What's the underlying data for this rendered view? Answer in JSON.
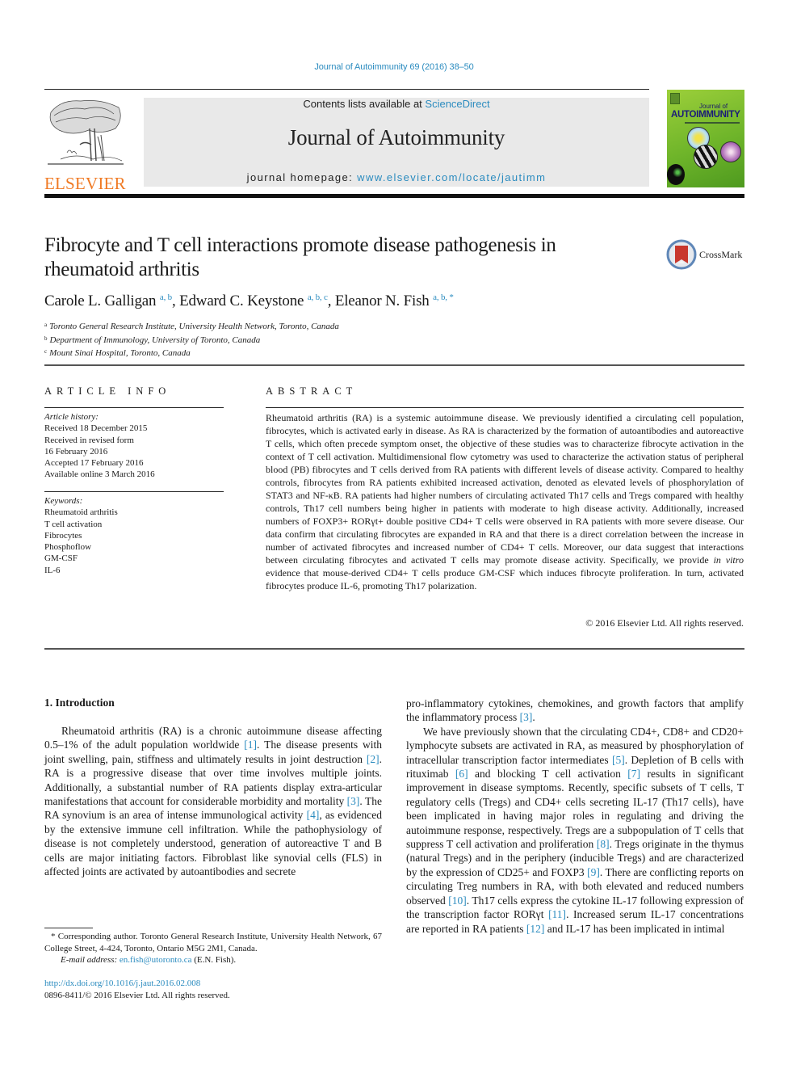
{
  "header": {
    "journal_reference": "Journal of Autoimmunity 69 (2016) 38–50",
    "publisher_wordmark": "ELSEVIER",
    "contents_prefix": "Contents lists available at ",
    "contents_link": "ScienceDirect",
    "journal_title": "Journal of Autoimmunity",
    "homepage_prefix": "journal homepage: ",
    "homepage_link": "www.elsevier.com/locate/jautimm",
    "cover": {
      "small_text": "Journal of",
      "big_text": "AUTOIMMUNITY"
    },
    "colors": {
      "link": "#2a8bbf",
      "elsevier_orange": "#f07a24",
      "cover_green": "#7dbf2e"
    }
  },
  "article": {
    "title": "Fibrocyte and T cell interactions promote disease pathogenesis in rheumatoid arthritis",
    "crossmark_label": "CrossMark",
    "authors": [
      {
        "name": "Carole L. Galligan",
        "sup": "a, b",
        "sep": ", "
      },
      {
        "name": "Edward C. Keystone",
        "sup": "a, b, c",
        "sep": ", "
      },
      {
        "name": "Eleanor N. Fish",
        "sup": "a, b, *",
        "sep": ""
      }
    ],
    "affiliations": [
      {
        "key": "a",
        "text": "Toronto General Research Institute, University Health Network, Toronto, Canada"
      },
      {
        "key": "b",
        "text": "Department of Immunology, University of Toronto, Canada"
      },
      {
        "key": "c",
        "text": "Mount Sinai Hospital, Toronto, Canada"
      }
    ]
  },
  "article_info": {
    "heading": "ARTICLE INFO",
    "history_label": "Article history:",
    "history": [
      "Received 18 December 2015",
      "Received in revised form",
      "16 February 2016",
      "Accepted 17 February 2016",
      "Available online 3 March 2016"
    ],
    "keywords_label": "Keywords:",
    "keywords": [
      "Rheumatoid arthritis",
      "T cell activation",
      "Fibrocytes",
      "Phosphoflow",
      "GM-CSF",
      "IL-6"
    ]
  },
  "abstract": {
    "heading": "ABSTRACT",
    "text_before_italic": "Rheumatoid arthritis (RA) is a systemic autoimmune disease. We previously identified a circulating cell population, fibrocytes, which is activated early in disease. As RA is characterized by the formation of autoantibodies and autoreactive T cells, which often precede symptom onset, the objective of these studies was to characterize fibrocyte activation in the context of T cell activation. Multidimensional flow cytometry was used to characterize the activation status of peripheral blood (PB) fibrocytes and T cells derived from RA patients with different levels of disease activity. Compared to healthy controls, fibro­cytes from RA patients exhibited increased activation, denoted as elevated levels of phosphorylation of STAT3 and NF-κB. RA patients had higher numbers of circulating activated Th17 cells and Tregs compared with healthy controls, Th17 cell numbers being higher in patients with moderate to high disease activity. Additionally, increased numbers of FOXP3+ RORγt+ double positive CD4+ T cells were observed in RA patients with more severe disease. Our data confirm that circulating fibrocytes are expanded in RA and that there is a direct correlation between the increase in number of activated fibrocytes and increased number of CD4+ T cells. Moreover, our data suggest that interactions between circulating fibrocytes and activated T cells may promote disease activity. Specifically, we provide ",
    "italic": "in vitro",
    "text_after_italic": " evidence that mouse-derived CD4+ T cells produce GM-CSF which induces fibrocyte proliferation. In turn, activated fibro­cytes produce IL-6, promoting Th17 polarization.",
    "copyright": "© 2016 Elsevier Ltd. All rights reserved."
  },
  "introduction": {
    "heading": "1.  Introduction",
    "left_column": [
      {
        "t": "Rheumatoid arthritis (RA) is a chronic autoimmune disease affecting 0.5–1% of the adult population worldwide "
      },
      {
        "ref": "[1]"
      },
      {
        "t": ". The disease presents with joint swelling, pain, stiffness and ultimately results in joint destruction "
      },
      {
        "ref": "[2]"
      },
      {
        "t": ". RA is a progressive disease that over time involves multiple joints. Additionally, a substantial number of RA patients display extra-articular manifestations that account for considerable morbidity and mortality "
      },
      {
        "ref": "[3]"
      },
      {
        "t": ". The RA synovium is an area of intense immunological activity "
      },
      {
        "ref": "[4]"
      },
      {
        "t": ", as evidenced by the extensive immune cell infiltration. While the pathophysiology of disease is not completely understood, generation of autoreactive T and B cells are major initiating factors. Fibroblast like synovial cells (FLS) in affected joints are activated by autoantibodies and secrete"
      }
    ],
    "right_para1": [
      {
        "t": "pro-inflammatory cytokines, chemokines, and growth factors that amplify the inflammatory process "
      },
      {
        "ref": "[3]"
      },
      {
        "t": "."
      }
    ],
    "right_para2": [
      {
        "t": "We have previously shown that the circulating CD4+, CD8+ and CD20+ lymphocyte subsets are activated in RA, as measured by phosphorylation of intracellular transcription factor intermediates "
      },
      {
        "ref": "[5]"
      },
      {
        "t": ". Depletion of B cells with rituximab "
      },
      {
        "ref": "[6]"
      },
      {
        "t": " and blocking T cell activation "
      },
      {
        "ref": "[7]"
      },
      {
        "t": " results in significant improvement in disease symp­toms. Recently, specific subsets of T cells, T regulatory cells (Tregs) and CD4+ cells secreting IL-17 (Th17 cells), have been implicated in having major roles in regulating and driving the autoimmune response, respectively. Tregs are a subpopulation of T cells that suppress T cell activation and proliferation "
      },
      {
        "ref": "[8]"
      },
      {
        "t": ". Tregs originate in the thymus (natural Tregs) and in the periphery (inducible Tregs) and are characterized by the expression of CD25+ and FOXP3 "
      },
      {
        "ref": "[9]"
      },
      {
        "t": ". There are conflicting reports on circulating Treg numbers in RA, with both elevated and reduced numbers observed "
      },
      {
        "ref": "[10]"
      },
      {
        "t": ". Th17 cells express the cytokine IL-17 following expression of the transcription factor RORγt "
      },
      {
        "ref": "[11]"
      },
      {
        "t": ". Increased serum IL-17 concentrations are re­ported in RA patients "
      },
      {
        "ref": "[12]"
      },
      {
        "t": " and IL-17 has been implicated in intimal"
      }
    ]
  },
  "footnote": {
    "corresponding": "* Corresponding author. Toronto General Research Institute, University Health Network, 67 College Street, 4-424, Toronto, Ontario M5G 2M1, Canada.",
    "email_label": "E-mail address:",
    "email": "en.fish@utoronto.ca",
    "email_suffix": " (E.N. Fish).",
    "doi": "http://dx.doi.org/10.1016/j.jaut.2016.02.008",
    "issn": "0896-8411/© 2016 Elsevier Ltd. All rights reserved."
  }
}
